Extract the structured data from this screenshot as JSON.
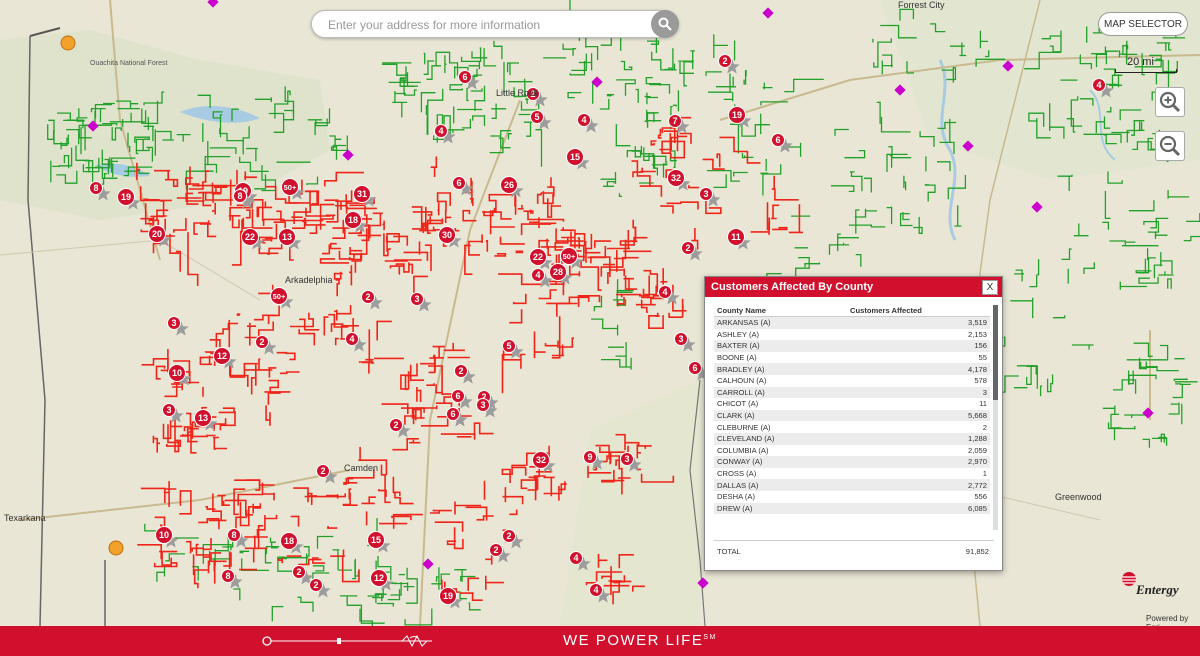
{
  "search": {
    "placeholder": "Enter your address for more information"
  },
  "map_selector_label": "MAP SELECTOR",
  "scale_label": "20 mi",
  "map_labels": [
    {
      "text": "Little Rock"
    },
    {
      "text": "Arkadelphia"
    },
    {
      "text": "Camden"
    },
    {
      "text": "Texarkana"
    },
    {
      "text": "Forrest City"
    },
    {
      "text": "Greenwood"
    },
    {
      "text": "Ouachita National Forest"
    }
  ],
  "outage_markers": [
    "6",
    "2",
    "5",
    "4",
    "4",
    "7",
    "19",
    "6",
    "15",
    "2",
    "8",
    "19",
    "19",
    "50+",
    "31",
    "6",
    "26",
    "32",
    "3",
    "4",
    "18",
    "20",
    "22",
    "13",
    "30",
    "22",
    "50+",
    "28",
    "2",
    "11",
    "50+",
    "2",
    "3",
    "4",
    "3",
    "4",
    "3",
    "12",
    "2",
    "5",
    "10",
    "3",
    "13",
    "2",
    "6",
    "2",
    "2",
    "32",
    "9",
    "3",
    "2",
    "10",
    "8",
    "18",
    "15",
    "2",
    "2",
    "8",
    "2",
    "12",
    "19",
    "4",
    "4",
    "6",
    "3",
    "8",
    "2",
    "6",
    "4"
  ],
  "popup": {
    "title": "Customers Affected By County",
    "close_label": "X",
    "col_county": "County Name",
    "col_customers": "Customers Affected",
    "rows": [
      {
        "county": "ARKANSAS (A)",
        "value": "3,519"
      },
      {
        "county": "ASHLEY (A)",
        "value": "2,153"
      },
      {
        "county": "BAXTER (A)",
        "value": "156"
      },
      {
        "county": "BOONE (A)",
        "value": "55"
      },
      {
        "county": "BRADLEY (A)",
        "value": "4,178"
      },
      {
        "county": "CALHOUN (A)",
        "value": "578"
      },
      {
        "county": "CARROLL (A)",
        "value": "3"
      },
      {
        "county": "CHICOT (A)",
        "value": "11"
      },
      {
        "county": "CLARK (A)",
        "value": "5,668"
      },
      {
        "county": "CLEBURNE (A)",
        "value": "2"
      },
      {
        "county": "CLEVELAND (A)",
        "value": "1,288"
      },
      {
        "county": "COLUMBIA (A)",
        "value": "2,059"
      },
      {
        "county": "CONWAY (A)",
        "value": "2,970"
      },
      {
        "county": "CROSS (A)",
        "value": "1"
      },
      {
        "county": "DALLAS (A)",
        "value": "2,772"
      },
      {
        "county": "DESHA (A)",
        "value": "556"
      },
      {
        "county": "DREW (A)",
        "value": "6,085"
      }
    ],
    "total_label": "TOTAL",
    "total_value": "91,852"
  },
  "brand": {
    "logo_text": "Entergy",
    "powered_by": "Powered by Esri",
    "slogan": "WE POWER LIFE",
    "slogan_mark": "SM",
    "accent_color": "#d0102d"
  },
  "colors": {
    "outage_line": "#f0251a",
    "grid_line": "#22a12a",
    "marker": "#d0102d",
    "diamond": "#cc00cc",
    "map_bg": "#e9e6d5"
  }
}
